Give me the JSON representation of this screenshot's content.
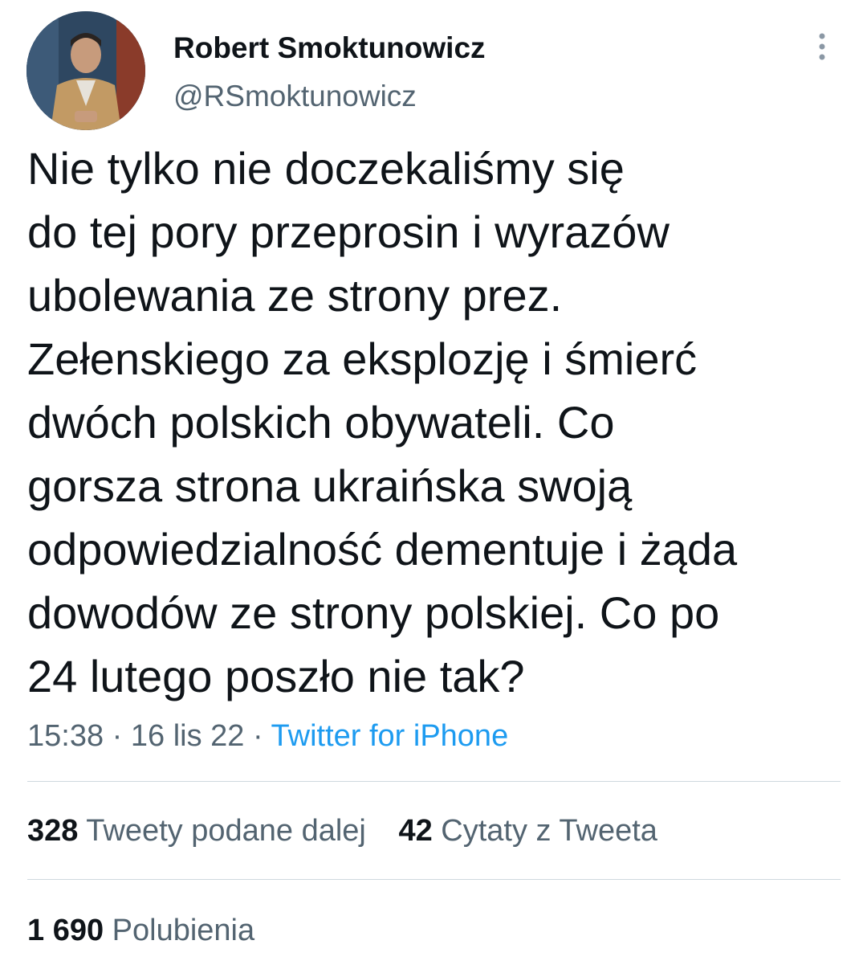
{
  "author": {
    "display_name": "Robert Smoktunowicz",
    "handle": "@RSmoktunowicz"
  },
  "tweet": {
    "text": "Nie tylko nie doczekaliśmy się\ndo tej pory przeprosin i wyrazów\nubolewania ze strony prez.\nZełenskiego za eksplozję i śmierć\ndwóch polskich obywateli. Co\ngorsza strona ukraińska swoją\nodpowiedzialność dementuje i żąda\ndowodów ze strony polskiej. Co po\n24 lutego poszło nie tak?",
    "time": "15:38",
    "separator": "·",
    "date": "16 lis 22",
    "source": "Twitter for iPhone"
  },
  "stats": {
    "retweets": {
      "count": "328",
      "label": "Tweety podane dalej"
    },
    "quotes": {
      "count": "42",
      "label": "Cytaty z Tweeta"
    },
    "likes": {
      "count": "1 690",
      "label": "Polubienia"
    }
  },
  "colors": {
    "text_primary": "#0f1419",
    "text_secondary": "#536471",
    "link": "#1d9bf0",
    "divider": "#cfd9de"
  },
  "icons": {
    "more": "more-vertical-icon"
  }
}
